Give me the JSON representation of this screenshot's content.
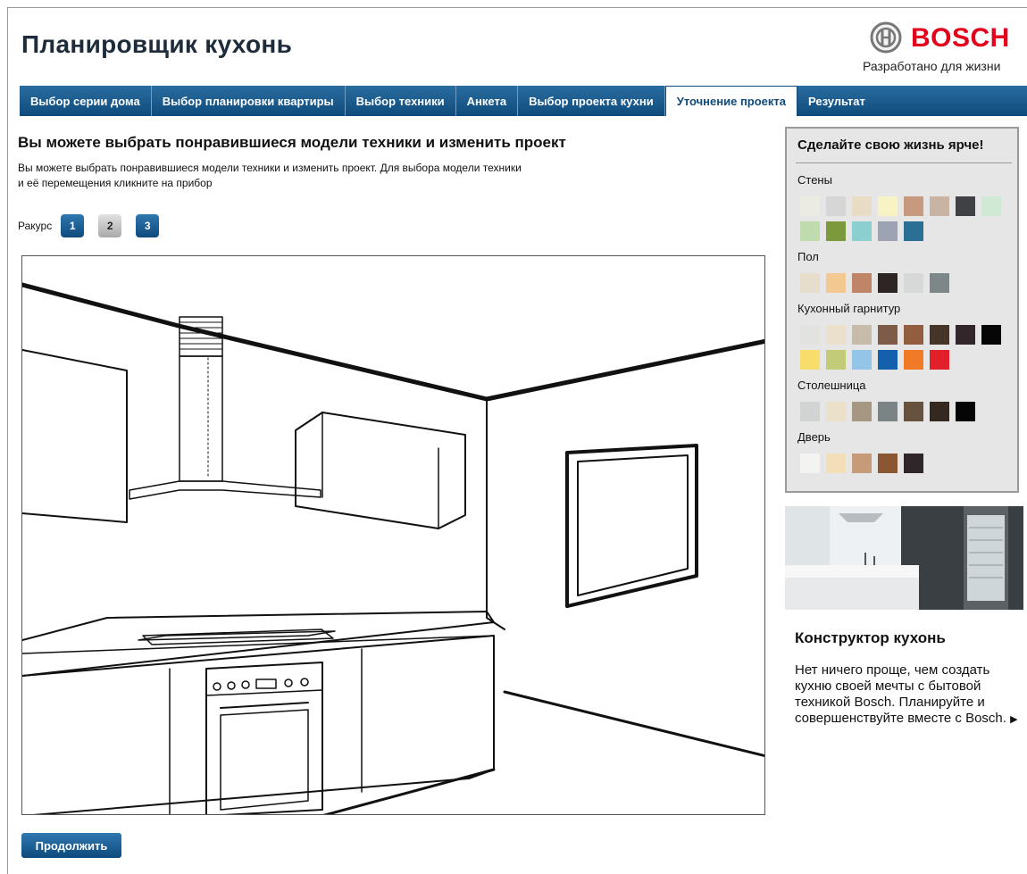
{
  "app": {
    "title": "Планировщик кухонь"
  },
  "brand": {
    "name": "BOSCH",
    "tagline": "Разработано для жизни"
  },
  "tabs": [
    {
      "label": "Выбор серии дома"
    },
    {
      "label": "Выбор планировки квартиры"
    },
    {
      "label": "Выбор техники"
    },
    {
      "label": "Анкета"
    },
    {
      "label": "Выбор проекта кухни"
    },
    {
      "label": "Уточнение проекта",
      "active": true
    },
    {
      "label": "Результат"
    }
  ],
  "main": {
    "heading": "Вы можете выбрать понравившиеся модели техники и изменить проект",
    "description_line1": "Вы можете выбрать понравившиеся модели техники и изменить проект. Для выбора модели техники",
    "description_line2": "и её перемещения кликните на прибор",
    "view_label": "Ракурс",
    "views": [
      "1",
      "2",
      "3"
    ],
    "selected_view": "2",
    "continue_label": "Продолжить"
  },
  "panel": {
    "title": "Сделайте свою жизнь ярче!",
    "sections": [
      {
        "label": "Стены",
        "colors": [
          "#ebebe4",
          "#d6d6d6",
          "#e8dcc5",
          "#f7f3c4",
          "#c79a7f",
          "#c9b3a3",
          "#3f4144",
          "#cfe9d5",
          "#c0dcae",
          "#7c9a3c",
          "#8ccfd0",
          "#9ea3b4",
          "#2b6f94"
        ]
      },
      {
        "label": "Пол",
        "colors": [
          "#e6ddcd",
          "#f3c991",
          "#c08468",
          "#2e2622",
          "#d7d8d8",
          "#7d8688"
        ]
      },
      {
        "label": "Кухонный гарнитур",
        "colors": [
          "#e2e2e0",
          "#ebe0cb",
          "#c7bba9",
          "#7d5b47",
          "#935e40",
          "#453528",
          "#32262a",
          "#060606",
          "#f6dd6c",
          "#c2cc78",
          "#94c4e6",
          "#1460ad",
          "#f07a26",
          "#e2202a"
        ]
      },
      {
        "label": "Столешница",
        "colors": [
          "#d2d3d3",
          "#ebe1cb",
          "#a69782",
          "#7c8386",
          "#66523e",
          "#342820",
          "#050505"
        ]
      },
      {
        "label": "Дверь",
        "colors": [
          "#f3f3f1",
          "#f2dfb8",
          "#c59b7a",
          "#8b5733",
          "#2e2629"
        ]
      }
    ]
  },
  "promo": {
    "title": "Конструктор кухонь",
    "text": "Нет ничего проще, чем создать кухню своей мечты с бытовой техникой Bosch. Планируйте и совершенствуйте вместе с Bosch.",
    "arrow": "▶"
  }
}
